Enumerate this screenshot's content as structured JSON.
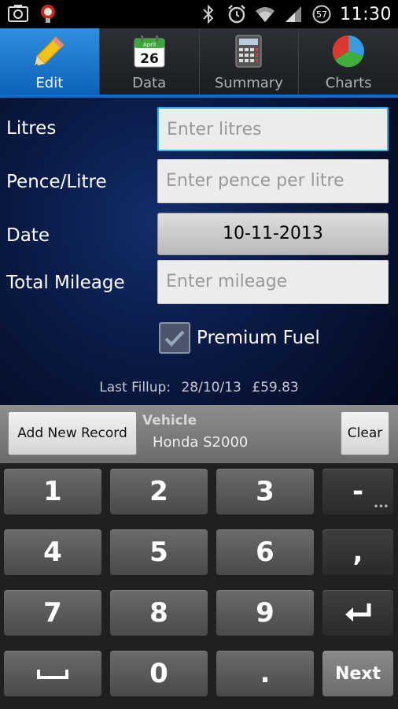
{
  "status_bar": {
    "time": "11:30",
    "notification_count": "57"
  },
  "tabs": [
    {
      "label": "Edit",
      "icon": "pencil-icon",
      "active": true
    },
    {
      "label": "Data",
      "icon": "calendar-icon",
      "calendar_month": "April",
      "calendar_day": "26"
    },
    {
      "label": "Summary",
      "icon": "calculator-icon"
    },
    {
      "label": "Charts",
      "icon": "pie-chart-icon"
    }
  ],
  "form": {
    "litres_label": "Litres",
    "litres_placeholder": "Enter litres",
    "ppl_label": "Pence/Litre",
    "ppl_placeholder": "Enter pence per litre",
    "date_label": "Date",
    "date_value": "10-11-2013",
    "mileage_label": "Total Mileage",
    "mileage_placeholder": "Enter mileage",
    "premium_label": "Premium Fuel",
    "premium_checked": true
  },
  "last_fillup": {
    "label": "Last Fillup:",
    "date": "28/10/13",
    "amount": "£59.83"
  },
  "actions": {
    "add_label": "Add New Record",
    "vehicle_title": "Vehicle",
    "vehicle_name": "Honda S2000",
    "clear_label": "Clear"
  },
  "keypad": {
    "k1": "1",
    "k2": "2",
    "k3": "3",
    "minus": "-",
    "k4": "4",
    "k5": "5",
    "k6": "6",
    "comma": ",",
    "k7": "7",
    "k8": "8",
    "k9": "9",
    "k0": "0",
    "dot": ".",
    "next": "Next"
  },
  "colors": {
    "accent": "#33b5e5",
    "tab_active": "#1a78d0",
    "form_bg": "#0a1a45"
  }
}
